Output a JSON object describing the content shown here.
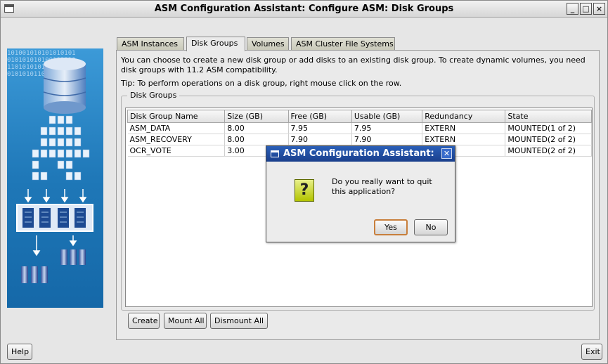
{
  "window": {
    "title": "ASM Configuration Assistant: Configure ASM: Disk Groups",
    "controls": [
      "_",
      "□",
      "×"
    ]
  },
  "tabs": [
    {
      "label": "ASM Instances",
      "active": false
    },
    {
      "label": "Disk Groups",
      "active": true
    },
    {
      "label": "Volumes",
      "active": false
    },
    {
      "label": "ASM Cluster File Systems",
      "active": false
    }
  ],
  "panel": {
    "description": "You can choose to create a new disk group or add disks to an existing disk group. To create dynamic volumes, you need disk groups with 11.2 ASM compatibility.",
    "tip": "Tip: To perform operations on a disk group, right mouse click on the row.",
    "group_label": "Disk Groups"
  },
  "table": {
    "columns": [
      "Disk Group Name",
      "Size (GB)",
      "Free (GB)",
      "Usable (GB)",
      "Redundancy",
      "State"
    ],
    "rows": [
      [
        "ASM_DATA",
        "8.00",
        "7.95",
        "7.95",
        "EXTERN",
        "MOUNTED(1 of 2)"
      ],
      [
        "ASM_RECOVERY",
        "8.00",
        "7.90",
        "7.90",
        "EXTERN",
        "MOUNTED(2 of 2)"
      ],
      [
        "OCR_VOTE",
        "3.00",
        "",
        "",
        "",
        "MOUNTED(2 of 2)"
      ]
    ]
  },
  "buttons": {
    "create": "Create",
    "mount_all": "Mount All",
    "dismount_all": "Dismount All",
    "help": "Help",
    "exit": "Exit"
  },
  "dialog": {
    "title": "ASM Configuration Assistant:",
    "message": "Do you really want to quit this application?",
    "yes": "Yes",
    "no": "No"
  },
  "colors": {
    "dialog_titlebar": "#2a5fb8",
    "question_icon": "#c8d600",
    "default_button_border": "#c87f3c"
  }
}
